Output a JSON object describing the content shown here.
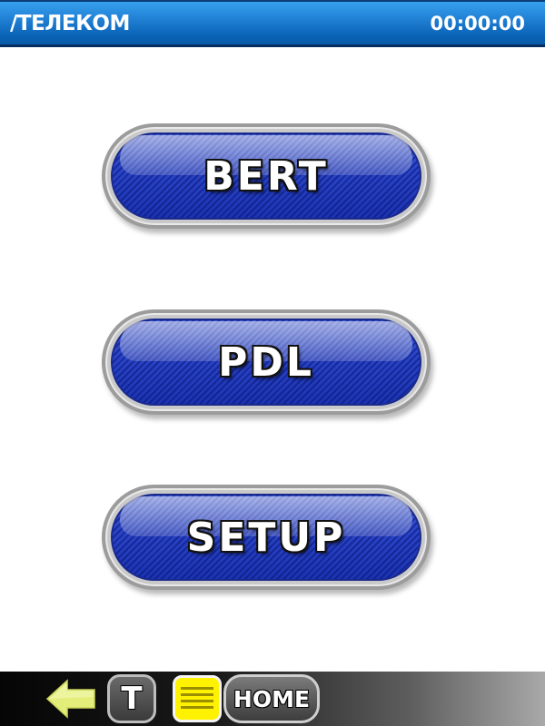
{
  "header": {
    "title": "/ТЕЛЕКОМ",
    "clock": "00:00:00"
  },
  "menu": {
    "buttons": [
      {
        "label": "BERT"
      },
      {
        "label": "PDL"
      },
      {
        "label": "SETUP"
      }
    ]
  },
  "toolbar": {
    "back_icon": "back-arrow-icon",
    "t_label": "T",
    "list_icon": "list-icon",
    "home_label": "HOME"
  },
  "colors": {
    "titlebar_blue": "#1f7fd3",
    "button_blue": "#2944c6",
    "toolbar_dark": "#1a1a1a",
    "list_yellow": "#fff200",
    "back_arrow_green": "#e3ee7a"
  }
}
